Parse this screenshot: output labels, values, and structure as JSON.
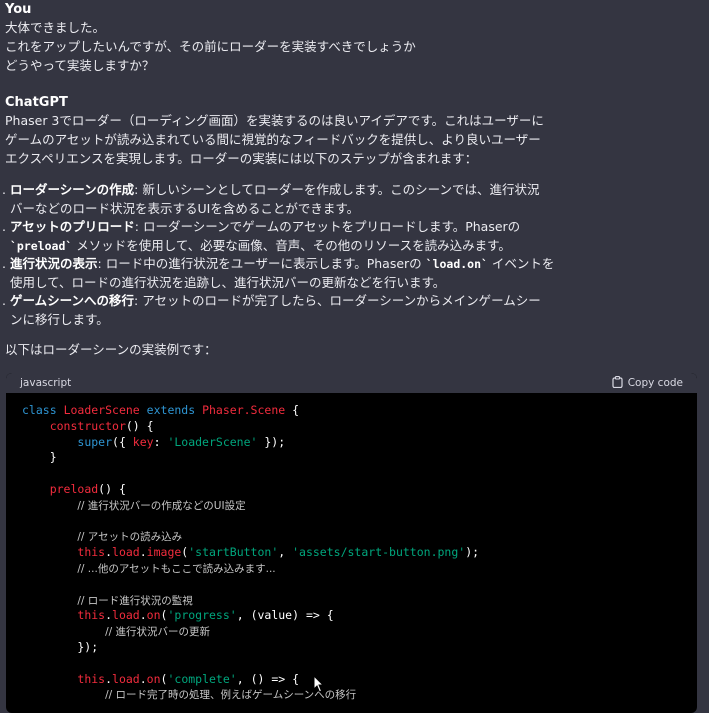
{
  "user": {
    "author": "You",
    "lines": [
      "大体できました。",
      "これをアップしたいんですが、その前にローダーを実装すべきでしょうか",
      "どうやって実装しますか？"
    ]
  },
  "assistant": {
    "author": "ChatGPT",
    "intro": [
      "Phaser 3でローダー（ローディング画面）を実装するのは良いアイデアです。これはユーザーに",
      "ゲームのアセットが読み込まれている間に視覚的なフィードバックを提供し、より良いユーザー",
      "エクスペリエンスを実現します。ローダーの実装には以下のステップが含まれます："
    ],
    "steps": [
      {
        "title": "ローダーシーンの作成",
        "l1": ": 新しいシーンとしてローダーを作成します。このシーンでは、進行状況",
        "l2": "バーなどのロード状況を表示するUIを含めることができます。"
      },
      {
        "title": "アセットのプリロード",
        "l1": ": ローダーシーンでゲームのアセットをプリロードします。Phaserの",
        "code": "`preload`",
        "l2": " メソッドを使用して、必要な画像、音声、その他のリソースを読み込みます。"
      },
      {
        "title": "進行状況の表示",
        "l1a": ": ロード中の進行状況をユーザーに表示します。Phaserの ",
        "code": "`load.on`",
        "l1b": " イベントを",
        "l2": "使用して、ロードの進行状況を追跡し、進行状況バーの更新などを行います。"
      },
      {
        "title": "ゲームシーンへの移行",
        "l1": ": アセットのロードが完了したら、ローダーシーンからメインゲームシー",
        "l2": "ンに移行します。"
      }
    ],
    "outro": "以下はローダーシーンの実装例です："
  },
  "code": {
    "language": "javascript",
    "copy_label": "Copy code",
    "c_progress_ui": "// 進行状況バーの作成などのUI設定",
    "c_assets": "// アセットの読み込み",
    "c_others": "// ...他のアセットもここで読み込みます...",
    "c_monitor": "// ロード進行状況の監視",
    "c_update": "// 進行状況バーの更新",
    "c_complete": "// ロード完了時の処理、例えばゲームシーンへの移行"
  },
  "colors": {
    "background": "#343541",
    "code_bg": "#000000",
    "keyword": "#2e95d3",
    "function": "#f22c3d",
    "string": "#00a67d"
  }
}
